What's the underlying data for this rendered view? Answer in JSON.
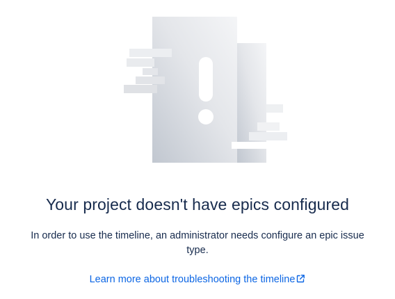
{
  "empty_state": {
    "illustration_icon": "warning-exclamation-icon",
    "title": "Your project doesn't have epics configured",
    "description": "In order to use the timeline, an administrator needs configure an epic issue type.",
    "link_label": "Learn more about troubleshooting the timeline",
    "link_icon": "external-link-icon",
    "link_color": "#0c66e4",
    "text_color": "#172b4d"
  }
}
